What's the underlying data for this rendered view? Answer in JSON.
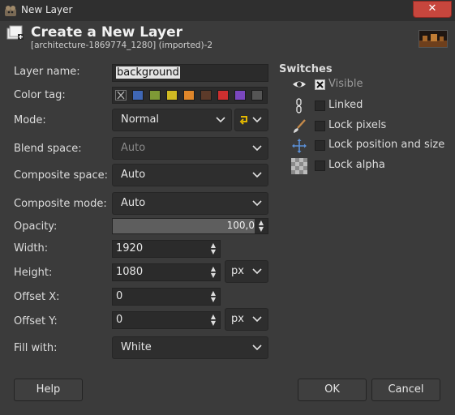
{
  "window": {
    "title": "New Layer",
    "close_glyph": "✕"
  },
  "header": {
    "title": "Create a New Layer",
    "subtitle": "[architecture-1869774_1280] (imported)-2"
  },
  "form": {
    "layer_name": {
      "label": "Layer name:",
      "value": "background"
    },
    "color_tag": {
      "label": "Color tag:",
      "colors": [
        "#3f67b5",
        "#7e9a36",
        "#d0ba22",
        "#df862a",
        "#5c3a29",
        "#cd2f2f",
        "#7a47be",
        "#555555"
      ]
    },
    "mode": {
      "label": "Mode:",
      "value": "Normal"
    },
    "blend_space": {
      "label": "Blend space:",
      "value": "Auto"
    },
    "composite_space": {
      "label": "Composite space:",
      "value": "Auto"
    },
    "composite_mode": {
      "label": "Composite mode:",
      "value": "Auto"
    },
    "opacity": {
      "label": "Opacity:",
      "value": "100,0",
      "level_percent": 100
    },
    "width": {
      "label": "Width:",
      "value": "1920"
    },
    "height": {
      "label": "Height:",
      "value": "1080",
      "unit": "px"
    },
    "offset_x": {
      "label": "Offset X:",
      "value": "0"
    },
    "offset_y": {
      "label": "Offset Y:",
      "value": "0",
      "unit": "px"
    },
    "fill_with": {
      "label": "Fill with:",
      "value": "White"
    }
  },
  "switches": {
    "heading": "Switches",
    "items": [
      {
        "label": "Visible",
        "checked": true,
        "icon": "eye-icon"
      },
      {
        "label": "Linked",
        "checked": false,
        "icon": "chain-icon"
      },
      {
        "label": "Lock pixels",
        "checked": false,
        "icon": "paintbrush-icon"
      },
      {
        "label": "Lock position and size",
        "checked": false,
        "icon": "move-icon"
      },
      {
        "label": "Lock alpha",
        "checked": false,
        "icon": "checkerboard-icon"
      }
    ]
  },
  "buttons": {
    "help": "Help",
    "ok": "OK",
    "cancel": "Cancel"
  }
}
